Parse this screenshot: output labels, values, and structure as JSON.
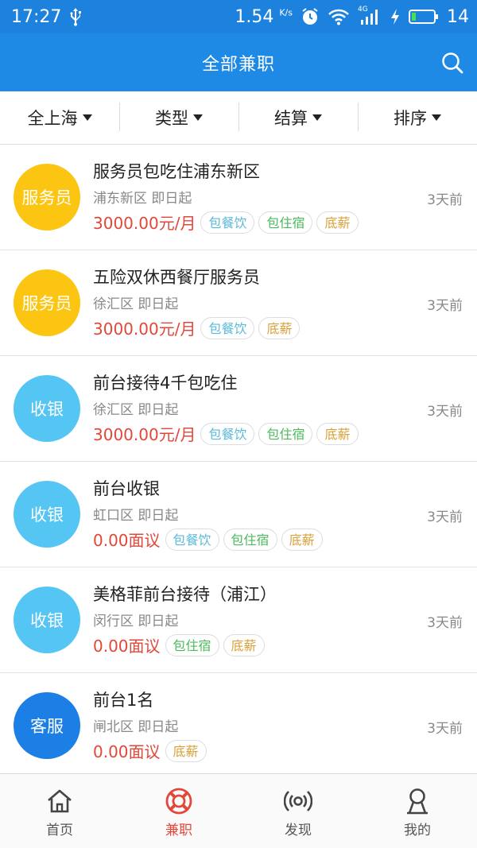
{
  "status_bar": {
    "time": "17:27",
    "speed": "1.54",
    "speed_unit": "K/s",
    "network": "4G",
    "battery": "14"
  },
  "header": {
    "title": "全部兼职"
  },
  "filters": [
    {
      "label": "全上海"
    },
    {
      "label": "类型"
    },
    {
      "label": "结算"
    },
    {
      "label": "排序"
    }
  ],
  "colors": {
    "primary": "#1f8ae6",
    "status_bar": "#1d82de",
    "salary": "#e2473a",
    "cat_waiter": "#fbc512",
    "cat_cashier": "#55c6f4",
    "cat_service": "#1c7fe6",
    "tag_food": "#5bb9d9",
    "tag_housing": "#4cb85c",
    "tag_salary": "#d9a13a"
  },
  "jobs": [
    {
      "category": "服务员",
      "category_color": "#fbc512",
      "title": "服务员包吃住浦东新区",
      "location": "浦东新区 即日起",
      "salary": "3000.00元/月",
      "time": "3天前",
      "tags": [
        {
          "text": "包餐饮",
          "color": "#5bb9d9"
        },
        {
          "text": "包住宿",
          "color": "#4cb85c"
        },
        {
          "text": "底薪",
          "color": "#d9a13a"
        }
      ]
    },
    {
      "category": "服务员",
      "category_color": "#fbc512",
      "title": "五险双休西餐厅服务员",
      "location": "徐汇区 即日起",
      "salary": "3000.00元/月",
      "time": "3天前",
      "tags": [
        {
          "text": "包餐饮",
          "color": "#5bb9d9"
        },
        {
          "text": "底薪",
          "color": "#d9a13a"
        }
      ]
    },
    {
      "category": "收银",
      "category_color": "#55c6f4",
      "title": "前台接待4千包吃住",
      "location": "徐汇区 即日起",
      "salary": "3000.00元/月",
      "time": "3天前",
      "tags": [
        {
          "text": "包餐饮",
          "color": "#5bb9d9"
        },
        {
          "text": "包住宿",
          "color": "#4cb85c"
        },
        {
          "text": "底薪",
          "color": "#d9a13a"
        }
      ]
    },
    {
      "category": "收银",
      "category_color": "#55c6f4",
      "title": "前台收银",
      "location": "虹口区 即日起",
      "salary": "0.00面议",
      "time": "3天前",
      "tags": [
        {
          "text": "包餐饮",
          "color": "#5bb9d9"
        },
        {
          "text": "包住宿",
          "color": "#4cb85c"
        },
        {
          "text": "底薪",
          "color": "#d9a13a"
        }
      ]
    },
    {
      "category": "收银",
      "category_color": "#55c6f4",
      "title": "美格菲前台接待（浦江）",
      "location": "闵行区 即日起",
      "salary": "0.00面议",
      "time": "3天前",
      "tags": [
        {
          "text": "包住宿",
          "color": "#4cb85c"
        },
        {
          "text": "底薪",
          "color": "#d9a13a"
        }
      ]
    },
    {
      "category": "客服",
      "category_color": "#1c7fe6",
      "title": "前台1名",
      "location": "闸北区 即日起",
      "salary": "0.00面议",
      "time": "3天前",
      "tags": [
        {
          "text": "底薪",
          "color": "#d9a13a"
        }
      ]
    }
  ],
  "tabs": [
    {
      "label": "首页",
      "icon": "home-icon",
      "active": false
    },
    {
      "label": "兼职",
      "icon": "lifebuoy-icon",
      "active": true
    },
    {
      "label": "发现",
      "icon": "broadcast-icon",
      "active": false
    },
    {
      "label": "我的",
      "icon": "user-icon",
      "active": false
    }
  ]
}
